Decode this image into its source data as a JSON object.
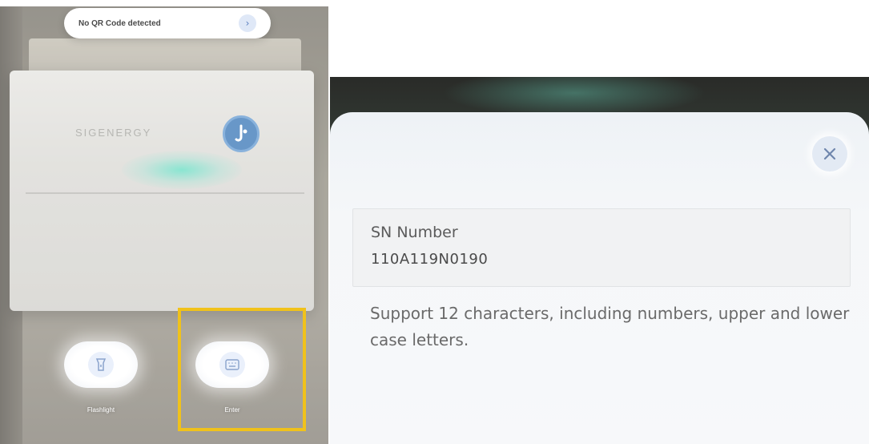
{
  "scanner": {
    "qr_status": "No QR Code detected",
    "arrow_icon": "chevron-right-icon",
    "device_brand": "SIGENERGY",
    "flashlight_label": "Flashlight",
    "flashlight_icon": "flashlight-icon",
    "enter_label": "Enter",
    "enter_icon": "keyboard-icon",
    "highlight_color": "#f0c21b"
  },
  "dialog": {
    "close_icon": "close-icon",
    "sn_label": "SN Number",
    "sn_value": "110A119N0190",
    "hint": "Support 12 characters, including numbers, upper and lower case letters."
  }
}
